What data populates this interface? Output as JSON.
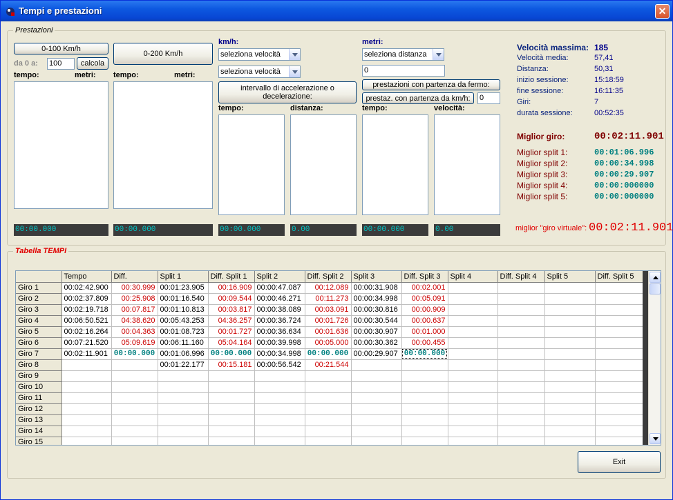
{
  "window": {
    "title": "Tempi e prestazioni",
    "close": "✕"
  },
  "prestazioni": {
    "group_title": "Prestazioni",
    "btn_0_100": "0-100 Km/h",
    "da0a_label": "da 0 a:",
    "da0a_value": "100",
    "calcola": "calcola",
    "tempo_label": "tempo:",
    "metri_label": "metri:",
    "btn_0_200": "0-200 Km/h",
    "tempo2_label": "tempo:",
    "metri2_label": "metri:",
    "kmh_label": "km/h:",
    "sel_vel_1": "seleziona velocità",
    "sel_vel_2": "seleziona velocità",
    "btn_interval": "intervallo di accelerazione o decelerazione:",
    "tempo3_label": "tempo:",
    "distanza_label": "distanza:",
    "metri3_label": "metri:",
    "sel_dist": "seleziona distanza",
    "dist_value": "0",
    "btn_partenza_fermo": "prestazioni con partenza da fermo:",
    "btn_partenza_kmh": "prestaz. con partenza da km/h:",
    "kmh_value": "0",
    "tempo4_label": "tempo:",
    "velocita_label": "velocità:",
    "displays": [
      "00:00.000",
      "00:00.000",
      "00:00.000",
      "0.00",
      "00:00.000",
      "0.00"
    ]
  },
  "stats": {
    "vel_max_label": "Velocità massima:",
    "vel_max": "185",
    "vel_media_label": "Velocità media:",
    "vel_media": "57,41",
    "distanza_label": "Distanza:",
    "distanza": "50,31",
    "inizio_label": "inizio sessione:",
    "inizio": "15:18:59",
    "fine_label": "fine sessione:",
    "fine": "16:11:35",
    "giri_label": "Giri:",
    "giri": "7",
    "durata_label": "durata sessione:",
    "durata": "00:52:35",
    "miglior_giro_label": "Miglior giro:",
    "miglior_giro": "00:02:11.901",
    "split1_label": "Miglior split 1:",
    "split1": "00:01:06.996",
    "split2_label": "Miglior split 2:",
    "split2": "00:00:34.998",
    "split3_label": "Miglior split 3:",
    "split3": "00:00:29.907",
    "split4_label": "Miglior split 4:",
    "split4": "00:00:000000",
    "split5_label": "Miglior split 5:",
    "split5": "00:00:000000",
    "virtuale_label": "miglior \"giro virtuale\":",
    "virtuale": "00:02:11.901"
  },
  "tabella": {
    "group_title": "Tabella TEMPI",
    "columns": [
      "",
      "Tempo",
      "Diff.",
      "Split 1",
      "Diff. Split 1",
      "Split 2",
      "Diff. Split 2",
      "Split 3",
      "Diff. Split 3",
      "Split 4",
      "Diff. Split 4",
      "Split 5",
      "Diff. Split 5"
    ],
    "rows": [
      [
        "Giro 1",
        "00:02:42.900",
        "00:30.999",
        "00:01:23.905",
        "00:16.909",
        "00:00:47.087",
        "00:12.089",
        "00:00:31.908",
        "00:02.001",
        "",
        "",
        "",
        ""
      ],
      [
        "Giro 2",
        "00:02:37.809",
        "00:25.908",
        "00:01:16.540",
        "00:09.544",
        "00:00:46.271",
        "00:11.273",
        "00:00:34.998",
        "00:05.091",
        "",
        "",
        "",
        ""
      ],
      [
        "Giro 3",
        "00:02:19.718",
        "00:07.817",
        "00:01:10.813",
        "00:03.817",
        "00:00:38.089",
        "00:03.091",
        "00:00:30.816",
        "00:00.909",
        "",
        "",
        "",
        ""
      ],
      [
        "Giro 4",
        "00:06:50.521",
        "04:38.620",
        "00:05:43.253",
        "04:36.257",
        "00:00:36.724",
        "00:01.726",
        "00:00:30.544",
        "00:00.637",
        "",
        "",
        "",
        ""
      ],
      [
        "Giro 5",
        "00:02:16.264",
        "00:04.363",
        "00:01:08.723",
        "00:01.727",
        "00:00:36.634",
        "00:01.636",
        "00:00:30.907",
        "00:01.000",
        "",
        "",
        "",
        ""
      ],
      [
        "Giro 6",
        "00:07:21.520",
        "05:09.619",
        "00:06:11.160",
        "05:04.164",
        "00:00:39.998",
        "00:05.000",
        "00:00:30.362",
        "00:00.455",
        "",
        "",
        "",
        ""
      ],
      [
        "Giro 7",
        "00:02:11.901",
        "00:00.000",
        "00:01:06.996",
        "00:00.000",
        "00:00:34.998",
        "00:00.000",
        "00:00:29.907",
        "00:00.000",
        "",
        "",
        "",
        ""
      ],
      [
        "Giro 8",
        "",
        "",
        "00:01:22.177",
        "00:15.181",
        "00:00:56.542",
        "00:21.544",
        "",
        "",
        "",
        "",
        "",
        ""
      ],
      [
        "Giro 9",
        "",
        "",
        "",
        "",
        "",
        "",
        "",
        "",
        "",
        "",
        "",
        ""
      ],
      [
        "Giro 10",
        "",
        "",
        "",
        "",
        "",
        "",
        "",
        "",
        "",
        "",
        "",
        ""
      ],
      [
        "Giro 11",
        "",
        "",
        "",
        "",
        "",
        "",
        "",
        "",
        "",
        "",
        "",
        ""
      ],
      [
        "Giro 12",
        "",
        "",
        "",
        "",
        "",
        "",
        "",
        "",
        "",
        "",
        "",
        ""
      ],
      [
        "Giro 13",
        "",
        "",
        "",
        "",
        "",
        "",
        "",
        "",
        "",
        "",
        "",
        ""
      ],
      [
        "Giro 14",
        "",
        "",
        "",
        "",
        "",
        "",
        "",
        "",
        "",
        "",
        "",
        ""
      ],
      [
        "Giro 15",
        "",
        "",
        "",
        "",
        "",
        "",
        "",
        "",
        "",
        "",
        "",
        ""
      ]
    ]
  },
  "exit": "Exit"
}
